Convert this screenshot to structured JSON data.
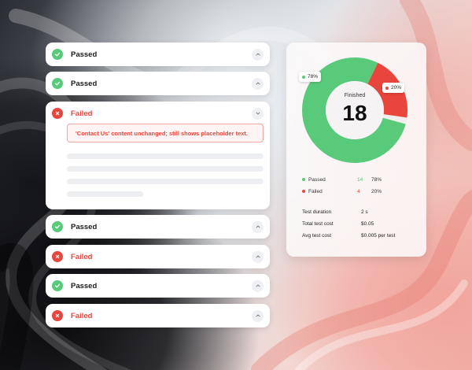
{
  "results": [
    {
      "status": "pass",
      "label": "Passed",
      "expanded": false
    },
    {
      "status": "pass",
      "label": "Passed",
      "expanded": false
    },
    {
      "status": "fail",
      "label": "Failed",
      "expanded": true,
      "error": "'Contact Us' content unchanged; still shows placeholder text."
    },
    {
      "status": "pass",
      "label": "Passed",
      "expanded": false
    },
    {
      "status": "fail",
      "label": "Failed",
      "expanded": false
    },
    {
      "status": "pass",
      "label": "Passed",
      "expanded": false
    },
    {
      "status": "fail",
      "label": "Failed",
      "expanded": false
    }
  ],
  "summary": {
    "center_label": "Finished",
    "center_value": "18",
    "pass_tag": "78%",
    "fail_tag": "20%",
    "legend": [
      {
        "name": "Passed",
        "count": "14",
        "percent": "78%",
        "color": "#59c97a"
      },
      {
        "name": "Failed",
        "count": "4",
        "percent": "20%",
        "color": "#e8453c"
      }
    ],
    "stats": [
      {
        "key": "Test duration",
        "value": "2 s"
      },
      {
        "key": "Total test cost",
        "value": "$0.05"
      },
      {
        "key": "Avg test cost",
        "value": "$0.005 per test"
      }
    ]
  },
  "colors": {
    "pass": "#59c97a",
    "fail": "#e8453c"
  },
  "icons": {
    "pass": "check-icon",
    "fail": "x-icon",
    "toggle_collapsed": "chevron-up-icon",
    "toggle_expanded": "chevron-down-icon"
  }
}
